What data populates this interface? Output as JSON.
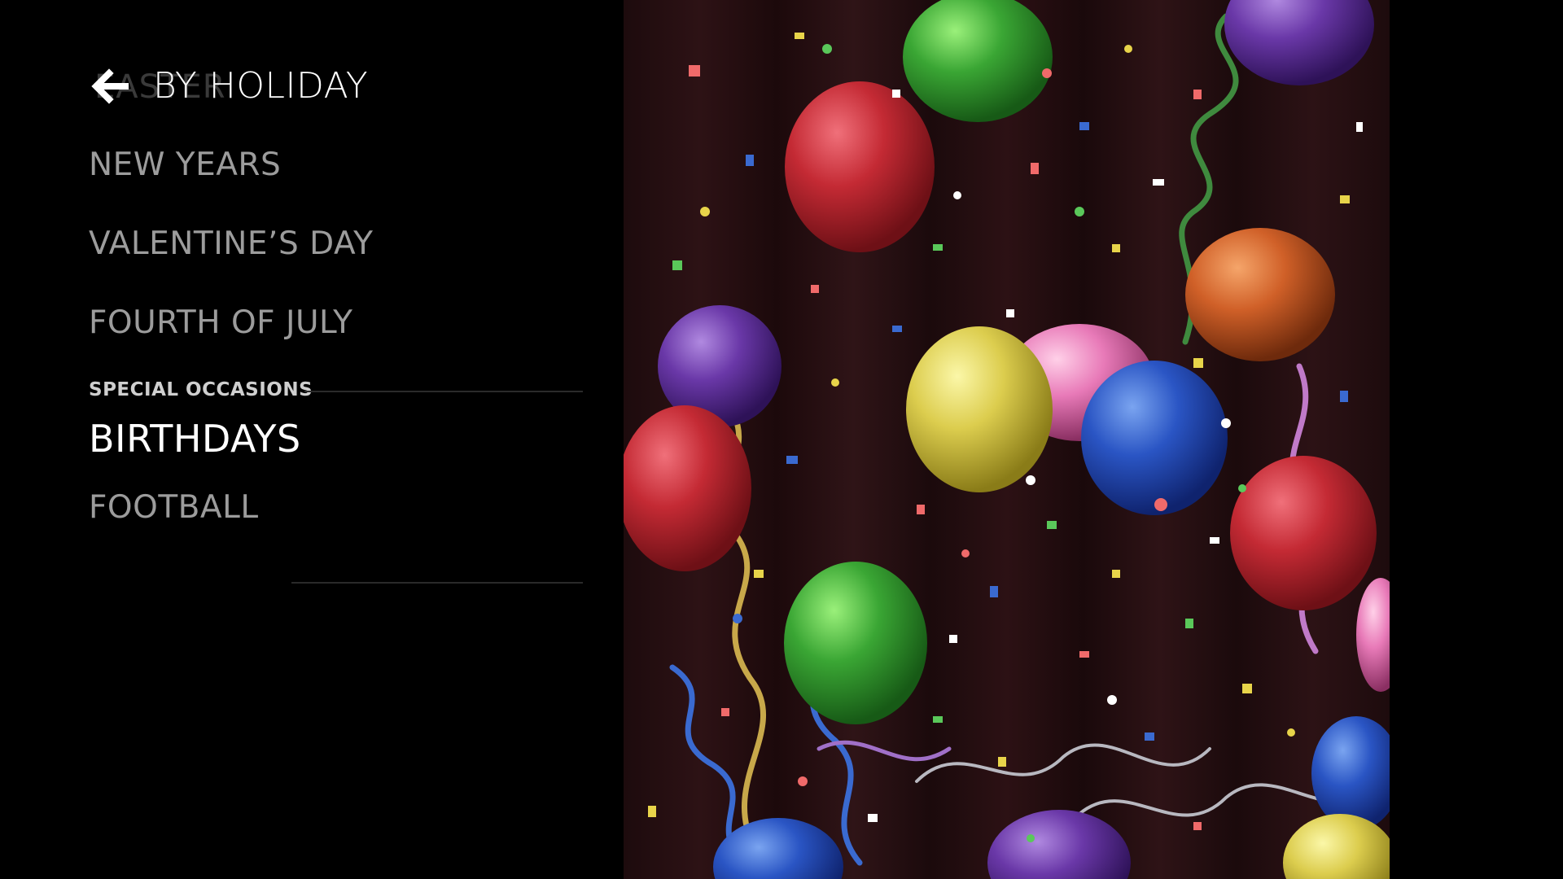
{
  "menu": {
    "ghost_label": "EASTER",
    "header_title": "BY HOLIDAY",
    "items": [
      {
        "label": "NEW YEARS"
      },
      {
        "label": "VALENTINE’S DAY"
      },
      {
        "label": "FOURTH OF JULY"
      }
    ],
    "section_label": "SPECIAL OCCASIONS",
    "special_items": [
      {
        "label": "BIRTHDAYS",
        "selected": true
      },
      {
        "label": "FOOTBALL",
        "selected": false
      }
    ]
  },
  "preview": {
    "scene": "birthday balloons and confetti"
  },
  "colors": {
    "background": "#000000",
    "text_selected": "#ffffff",
    "text_normal": "#9c9c9c"
  }
}
